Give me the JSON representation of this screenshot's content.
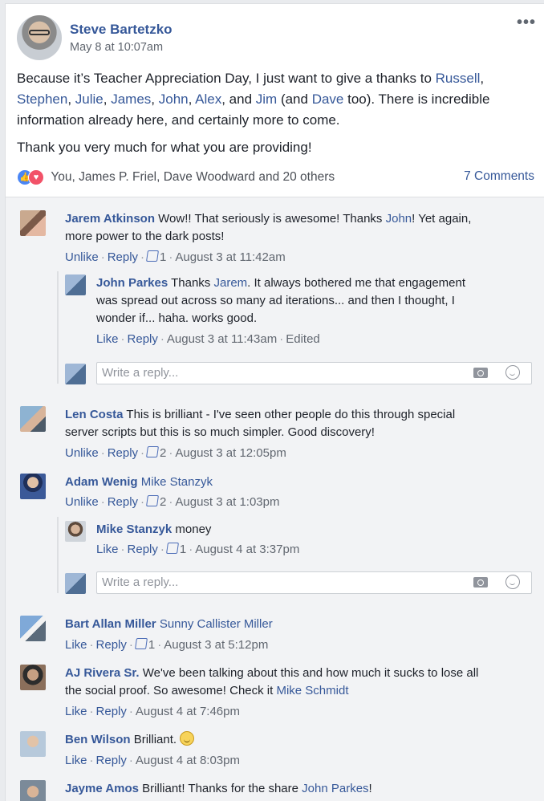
{
  "post": {
    "author": "Steve Bartetzko",
    "timestamp": "May 8 at 10:07am",
    "more_label": "•••",
    "p1_start": "Because it’s Teacher Appreciation Day, I just want to give a thanks to ",
    "mentions": [
      "Russell",
      "Stephen",
      "Julie",
      "James",
      "John",
      "Alex",
      "Jim",
      "Dave"
    ],
    "sep_comma": ", ",
    "sep_and": ", and ",
    "sep_paren": " (and ",
    "p1_end": " too). There is incredible information already here, and certainly more to come.",
    "p2": "Thank you very much for what you are providing!",
    "reactions_text": "You, James P. Friel, Dave Woodward and 20 others",
    "comments_count": "7 Comments"
  },
  "comments": [
    {
      "name": "Jarem Atkinson",
      "text_a": " Wow!! That seriously is awesome! Thanks ",
      "tag": "John",
      "text_b": "! Yet again,",
      "line2": "more power to the dark posts!",
      "meta": {
        "unlike": "Unlike",
        "reply": "Reply",
        "likes": "1",
        "time": "August 3 at 11:42am"
      }
    },
    {
      "name": "John Parkes",
      "text_a": " Thanks ",
      "tag": "Jarem",
      "text_b": ". It always bothered me that engagement",
      "line2": "was spread out across so many ad iterations... and then I thought, I",
      "line3": "wonder if... haha. works good.",
      "meta": {
        "like": "Like",
        "reply": "Reply",
        "time": "August 3 at 11:43am",
        "edited": "Edited"
      }
    },
    {
      "name": "Len Costa",
      "text_a": " This is brilliant - I've seen other people do this through special",
      "line2": "server scripts but this is so much simpler. Good discovery!",
      "meta": {
        "unlike": "Unlike",
        "reply": "Reply",
        "likes": "2",
        "time": "August 3 at 12:05pm"
      }
    },
    {
      "name": "Adam Wenig",
      "tag": "Mike Stanzyk",
      "meta": {
        "unlike": "Unlike",
        "reply": "Reply",
        "likes": "2",
        "time": "August 3 at 1:03pm"
      }
    },
    {
      "name": "Mike Stanzyk",
      "text_a": " money",
      "meta": {
        "like": "Like",
        "reply": "Reply",
        "likes": "1",
        "time": "August 4 at 3:37pm"
      }
    },
    {
      "name": "Bart Allan Miller",
      "tag": "Sunny Callister Miller",
      "meta": {
        "like": "Like",
        "reply": "Reply",
        "likes": "1",
        "time": "August 3 at 5:12pm"
      }
    },
    {
      "name": "AJ Rivera Sr.",
      "text_a": " We've been talking about this and how much it sucks to lose all",
      "line2": "the social proof. So awesome! Check it ",
      "tag": "Mike Schmidt",
      "meta": {
        "like": "Like",
        "reply": "Reply",
        "time": "August 4 at 7:46pm"
      }
    },
    {
      "name": "Ben Wilson",
      "text_a": " Brilliant. ",
      "meta": {
        "like": "Like",
        "reply": "Reply",
        "time": "August 4 at 8:03pm"
      }
    },
    {
      "name": "Jayme Amos",
      "text_a": " Brilliant! Thanks for the share ",
      "tag": "John Parkes",
      "text_b": "!"
    }
  ],
  "reply_placeholder": "Write a reply..."
}
